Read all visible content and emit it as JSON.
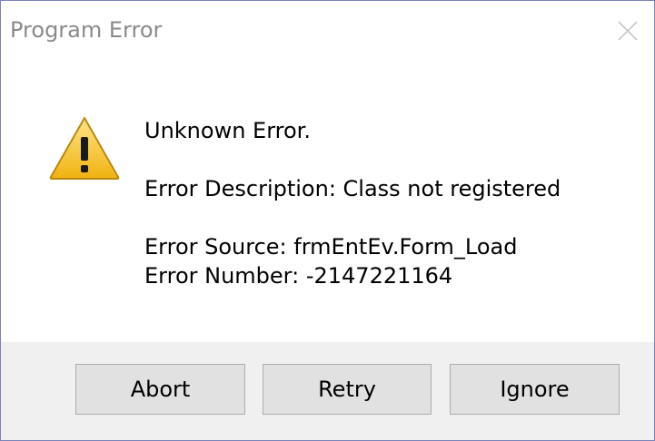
{
  "window": {
    "title": "Program Error"
  },
  "message": {
    "heading": "Unknown Error.",
    "description": "Error Description: Class not registered",
    "source": "Error Source: frmEntEv.Form_Load",
    "number": "Error Number: -2147221164"
  },
  "buttons": {
    "abort": "Abort",
    "retry": "Retry",
    "ignore": "Ignore"
  },
  "icons": {
    "warning": "warning-icon",
    "close": "close-icon"
  },
  "colors": {
    "footer_bg": "#f0f0f0",
    "button_bg": "#e1e1e1",
    "warning_yellow": "#f7c62f"
  }
}
